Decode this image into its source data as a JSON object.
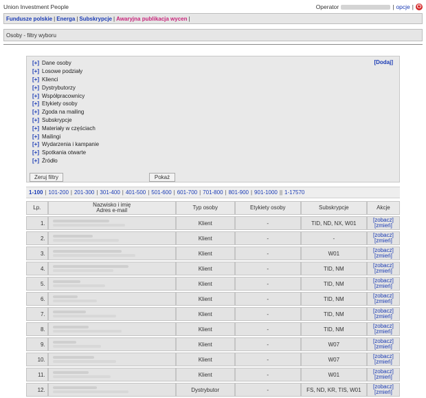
{
  "header": {
    "app_title": "Union Investment People",
    "operator_label": "Operator",
    "options_link": "opcje",
    "separator": "|",
    "power_glyph": "⏻"
  },
  "nav": {
    "items": [
      {
        "label": "Fundusze polskie",
        "alert": false
      },
      {
        "label": "Energa",
        "alert": false
      },
      {
        "label": "Subskrypcje",
        "alert": false
      },
      {
        "label": "Awaryjna publikacja wycen",
        "alert": true
      }
    ],
    "separator": "|"
  },
  "page": {
    "title": "Osoby - filtry wyboru"
  },
  "filters": {
    "toggle": "[+]",
    "add_link": "[Dodaj]",
    "items": [
      "Dane osoby",
      "Losowe podziały",
      "Klienci",
      "Dystrybutorzy",
      "Współpracownicy",
      "Etykiety osoby",
      "Zgoda na mailing",
      "Subskrypcje",
      "Materiały w częściach",
      "Mailingi",
      "Wydarzenia i kampanie",
      "Spotkania otwarte",
      "Źródło"
    ],
    "reset_button": "Zeruj filtry",
    "show_button": "Pokaż"
  },
  "pagination": {
    "pages": [
      "1-100",
      "101-200",
      "201-300",
      "301-400",
      "401-500",
      "501-600",
      "601-700",
      "701-800",
      "801-900",
      "901-1000"
    ],
    "current": "1-100",
    "total_link": "1-17570",
    "separator": "|",
    "double_separator": "||"
  },
  "table": {
    "headers": {
      "lp": "Lp.",
      "name_line1": "Nazwisko i imię",
      "name_line2": "Adres e-mail",
      "type": "Typ osoby",
      "labels": "Etykiety osoby",
      "subs": "Subskrypcje",
      "actions": "Akcje"
    },
    "action_view": "[zobacz]",
    "action_edit": "[zmień]",
    "rows": [
      {
        "lp": "1.",
        "type": "Klient",
        "labels": "-",
        "subs": "TID, ND, NX, W01"
      },
      {
        "lp": "2.",
        "type": "Klient",
        "labels": "-",
        "subs": "-"
      },
      {
        "lp": "3.",
        "type": "Klient",
        "labels": "-",
        "subs": "W01"
      },
      {
        "lp": "4.",
        "type": "Klient",
        "labels": "-",
        "subs": "TID, NM"
      },
      {
        "lp": "5.",
        "type": "Klient",
        "labels": "-",
        "subs": "TID, NM"
      },
      {
        "lp": "6.",
        "type": "Klient",
        "labels": "-",
        "subs": "TID, NM"
      },
      {
        "lp": "7.",
        "type": "Klient",
        "labels": "-",
        "subs": "TID, NM"
      },
      {
        "lp": "8.",
        "type": "Klient",
        "labels": "-",
        "subs": "TID, NM"
      },
      {
        "lp": "9.",
        "type": "Klient",
        "labels": "-",
        "subs": "W07"
      },
      {
        "lp": "10.",
        "type": "Klient",
        "labels": "-",
        "subs": "W07"
      },
      {
        "lp": "11.",
        "type": "Klient",
        "labels": "-",
        "subs": "W01"
      },
      {
        "lp": "12.",
        "type": "Dystrybutor",
        "labels": "-",
        "subs": "FS, ND, KR, TIS, W01"
      }
    ]
  }
}
